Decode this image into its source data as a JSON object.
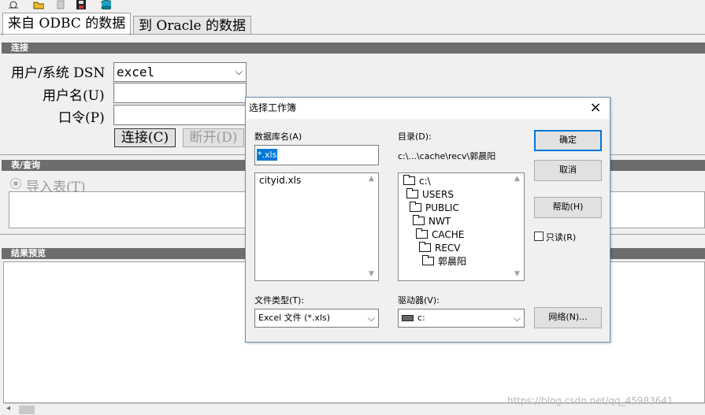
{
  "toolbar": {
    "icons": [
      "settings-icon",
      "open-folder-icon",
      "document-icon",
      "save-icon",
      "database-icon"
    ]
  },
  "tabs": [
    {
      "label": "来自 ODBC 的数据"
    },
    {
      "label": "到 Oracle 的数据"
    }
  ],
  "connect": {
    "section": "连接",
    "dsn_label": "用户/系统 DSN",
    "dsn_value": "excel",
    "username_label": "用户名(U)",
    "username_value": "",
    "password_label": "口令(P)",
    "password_value": "",
    "connect_button": "连接(C)",
    "disconnect_button": "断开(D)"
  },
  "table_query": {
    "section": "表/查询",
    "import_table_label": "导入表(T)"
  },
  "preview": {
    "section": "结果预览"
  },
  "dialog": {
    "title": "选择工作簿",
    "close": "×",
    "dbname_label": "数据库名(A)",
    "dbname_value": "*.xls",
    "files": [
      "cityid.xls"
    ],
    "dir_label": "目录(D):",
    "dir_value": "c:\\...\\cache\\recv\\郭晨阳",
    "tree": [
      "c:\\",
      "USERS",
      "PUBLIC",
      "NWT",
      "CACHE",
      "RECV",
      "郭晨阳"
    ],
    "ok_button": "确定",
    "cancel_button": "取消",
    "help_button": "帮助(H)",
    "readonly_label": "只读(R)",
    "readonly_checked": false,
    "filetype_label": "文件类型(T):",
    "filetype_value": "Excel 文件 (*.xls)",
    "drive_label": "驱动器(V):",
    "drive_value": "c:",
    "network_button": "网络(N)..."
  },
  "watermark": "https://blog.csdn.net/qq_45983641",
  "colors": {
    "section_bar": "#6d6d6d",
    "selection": "#0078d7",
    "dialog_border": "#6d8fb5"
  }
}
